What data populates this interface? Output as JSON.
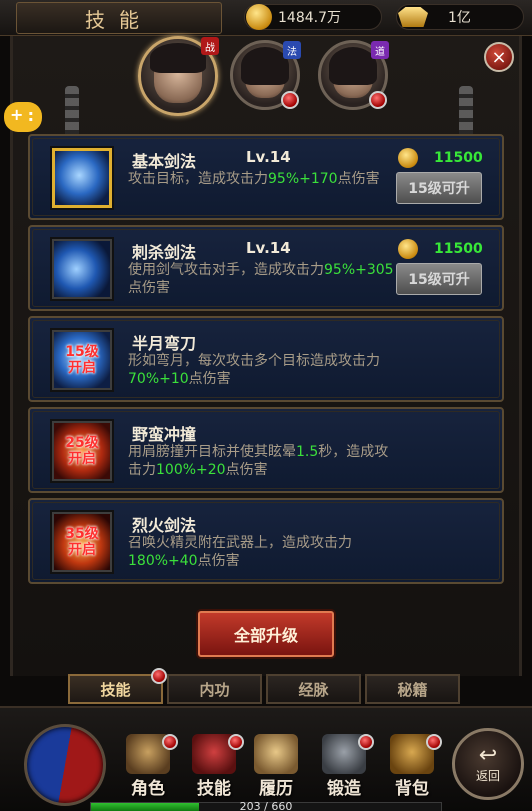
{
  "header": {
    "title": "技能",
    "gold_amount": "1484.7万",
    "ingot_amount": "1亿"
  },
  "characters": [
    {
      "role_tag": "战",
      "tag_color": "#b01818",
      "active": true
    },
    {
      "role_tag": "法",
      "tag_color": "#2a4ab0",
      "active": false
    },
    {
      "role_tag": "道",
      "tag_color": "#7a2ab0",
      "active": false
    }
  ],
  "close_label": "×",
  "skills": [
    {
      "name": "基本剑法",
      "level": "Lv.14",
      "desc_pre": "攻击目标，造成攻击力",
      "desc_green": "95%+170",
      "desc_post": "点伤害",
      "cost": "11500",
      "button": "15级可升",
      "icon": "sword-slash",
      "locked": false
    },
    {
      "name": "刺杀剑法",
      "level": "Lv.14",
      "desc_pre": "使用剑气攻击对手，造成攻击力",
      "desc_green": "95%+305",
      "desc_post": "点伤害",
      "cost": "11500",
      "button": "15级可升",
      "icon": "crescent-slash",
      "locked": false
    },
    {
      "name": "半月弯刀",
      "level": "",
      "desc_pre": "形如弯月，每次攻击多个目标造成攻击力",
      "desc_green": "70%+10",
      "desc_post": "点伤害",
      "unlock_line1": "15级",
      "unlock_line2": "开启",
      "icon": "half-moon",
      "locked": true
    },
    {
      "name": "野蛮冲撞",
      "level": "",
      "desc_pre": "用肩膀撞开目标并使其眩晕",
      "desc_green_inline": "1.5",
      "desc_mid": "秒，造成攻击力",
      "desc_green": "100%+20",
      "desc_post": "点伤害",
      "unlock_line1": "25级",
      "unlock_line2": "开启",
      "icon": "charge",
      "locked": true
    },
    {
      "name": "烈火剑法",
      "level": "",
      "desc_pre": "召唤火精灵附在武器上，造成攻击力",
      "desc_green": "180%+40",
      "desc_post": "点伤害",
      "unlock_line1": "35级",
      "unlock_line2": "开启",
      "icon": "flame-sword",
      "locked": true
    }
  ],
  "upgrade_all_label": "全部升级",
  "tabs": [
    {
      "label": "技能",
      "active": true
    },
    {
      "label": "内功",
      "active": false
    },
    {
      "label": "经脉",
      "active": false
    },
    {
      "label": "秘籍",
      "active": false
    }
  ],
  "bottom_nav": [
    {
      "label": "角色",
      "icon": "helmet-icon"
    },
    {
      "label": "技能",
      "icon": "skill-book-icon"
    },
    {
      "label": "履历",
      "icon": "scroll-icon"
    },
    {
      "label": "锻造",
      "icon": "anvil-icon"
    },
    {
      "label": "背包",
      "icon": "chest-icon"
    }
  ],
  "back_label": "返回",
  "exp": {
    "text": "203 / 660",
    "current": 203,
    "max": 660
  }
}
